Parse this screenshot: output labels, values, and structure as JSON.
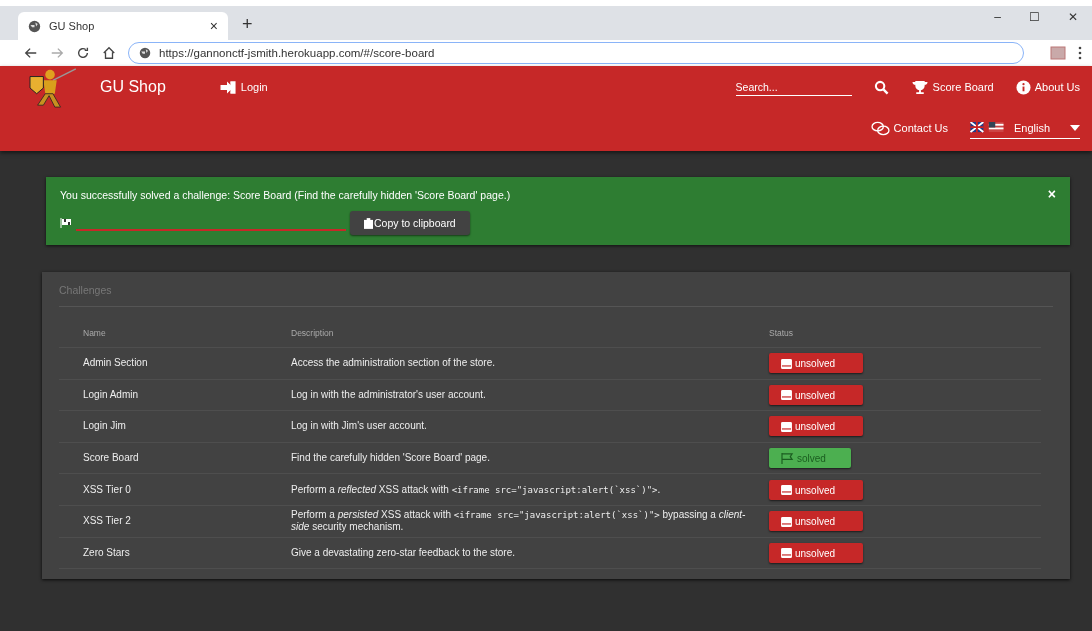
{
  "browser": {
    "tab_title": "GU Shop",
    "tab_close": "×",
    "new_tab": "+",
    "url": "https://gannonctf-jsmith.herokuapp.com/#/score-board",
    "window_controls": [
      "–",
      "☐",
      "✕"
    ]
  },
  "navbar": {
    "title": "GU Shop",
    "login": "Login",
    "search": {
      "placeholder": "Search..."
    },
    "score_board": "Score Board",
    "about": "About Us",
    "contact": "Contact Us",
    "language": "English"
  },
  "alert": {
    "message": "You successfully solved a challenge: Score Board (Find the carefully hidden 'Score Board' page.)",
    "close": "×",
    "copy_button": "Copy to clipboard"
  },
  "challenges": {
    "title": "Challenges",
    "columns": [
      "Name",
      "Description",
      "Status"
    ],
    "rows": [
      {
        "name": "Admin Section",
        "description": [
          {
            "kind": "text",
            "text": "Access the administration section of the store."
          }
        ],
        "status": "unsolved",
        "solved": false
      },
      {
        "name": "Login Admin",
        "description": [
          {
            "kind": "text",
            "text": "Log in with the administrator's user account."
          }
        ],
        "status": "unsolved",
        "solved": false
      },
      {
        "name": "Login Jim",
        "description": [
          {
            "kind": "text",
            "text": "Log in with Jim's user account."
          }
        ],
        "status": "unsolved",
        "solved": false
      },
      {
        "name": "Score Board",
        "description": [
          {
            "kind": "text",
            "text": "Find the carefully hidden 'Score Board' page."
          }
        ],
        "status": "solved",
        "solved": true
      },
      {
        "name": "XSS Tier 0",
        "description": [
          {
            "kind": "text",
            "text": "Perform a *reflected* XSS attack with "
          },
          {
            "kind": "code",
            "text": "<iframe src=\"javascript:alert(`xss`)\">"
          },
          {
            "kind": "text",
            "text": "."
          }
        ],
        "status": "unsolved",
        "solved": false
      },
      {
        "name": "XSS Tier 2",
        "description": [
          {
            "kind": "text",
            "text": "Perform a *persisted* XSS attack with "
          },
          {
            "kind": "code",
            "text": "<iframe src=\"javascript:alert(`xss`)\">"
          },
          {
            "kind": "text",
            "text": " bypassing a *client-side* security mechanism."
          }
        ],
        "status": "unsolved",
        "solved": false
      },
      {
        "name": "Zero Stars",
        "description": [
          {
            "kind": "text",
            "text": "Give a devastating zero-star feedback to the store."
          }
        ],
        "status": "unsolved",
        "solved": false
      }
    ]
  }
}
